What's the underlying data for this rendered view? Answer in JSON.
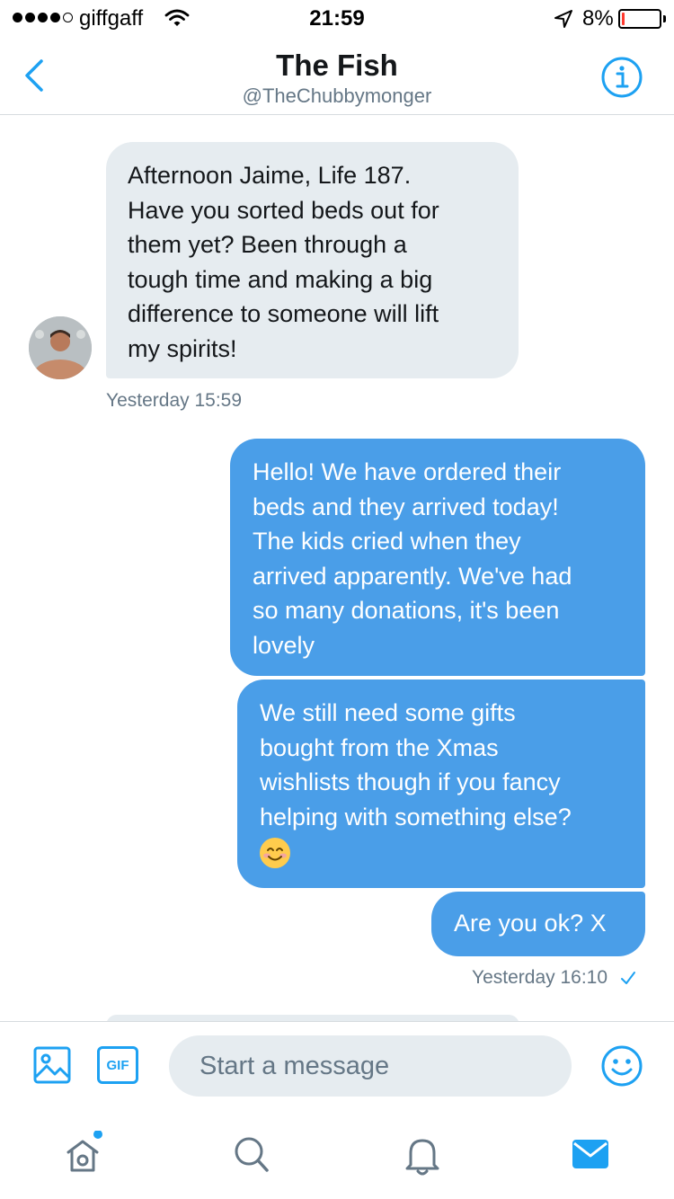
{
  "status_bar": {
    "carrier": "giffgaff",
    "signal_bars_filled": 4,
    "signal_bars_total": 5,
    "time": "21:59",
    "battery_percent": "8%",
    "battery_level": 0.08,
    "battery_color": "#ff3b30"
  },
  "header": {
    "title": "The Fish",
    "subtitle": "@TheChubbymonger",
    "back_icon": "chevron-left-icon",
    "info_icon": "info-icon"
  },
  "messages": [
    {
      "direction": "incoming",
      "text": "Afternoon Jaime, Life 187.\nHave you sorted beds out for\nthem yet? Been through a\ntough time and making a big\ndifference to someone will lift\nmy spirits!",
      "timestamp": "Yesterday 15:59"
    },
    {
      "direction": "outgoing",
      "text": "Hello! We have ordered their\nbeds and they arrived today!\nThe kids cried when they\narrived apparently. We've had\nso many donations, it's been\nlovely"
    },
    {
      "direction": "outgoing",
      "text": "We still need some gifts\nbought from the Xmas\nwishlists though if you fancy\nhelping with something else?",
      "emoji": "smiling-face-emoji"
    },
    {
      "direction": "outgoing",
      "text": "Are you ok? X",
      "timestamp": "Yesterday 16:10",
      "read_receipt": "checkmark-icon"
    }
  ],
  "composer": {
    "placeholder": "Start a message",
    "gif_label": "GIF",
    "image_icon": "image-icon",
    "emoji_icon": "smiley-icon"
  },
  "tab_bar": {
    "items": [
      {
        "name": "home",
        "icon": "home-icon",
        "has_notification_dot": true
      },
      {
        "name": "search",
        "icon": "search-icon"
      },
      {
        "name": "notifications",
        "icon": "bell-icon"
      },
      {
        "name": "messages",
        "icon": "envelope-icon",
        "active": true
      }
    ]
  },
  "colors": {
    "accent": "#1da1f2",
    "outgoing_bubble": "#4a9ee8",
    "incoming_bubble": "#e6ecf0",
    "secondary_text": "#657786"
  }
}
